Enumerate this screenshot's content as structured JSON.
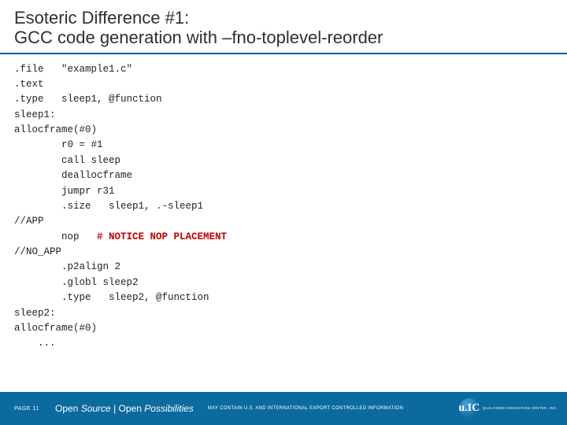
{
  "title": {
    "line1": "Esoteric Difference #1:",
    "line2": "GCC code generation with –fno-toplevel-reorder"
  },
  "code": {
    "l01": ".file   \"example1.c\"",
    "l02": ".text",
    "l03": ".type   sleep1, @function",
    "l04": "sleep1:",
    "l05": "allocframe(#0)",
    "l06": "        r0 = #1",
    "l07": "        call sleep",
    "l08": "        deallocframe",
    "l09": "        jumpr r31",
    "l10": "        .size   sleep1, .-sleep1",
    "l11": "//APP",
    "l12a": "        nop   ",
    "l12b": "# NOTICE NOP PLACEMENT",
    "l13": "//NO_APP",
    "l14": "        .p2align 2",
    "l15": "        .globl sleep2",
    "l16": "        .type   sleep2, @function",
    "l17": "sleep2:",
    "l18": "allocframe(#0)",
    "l19": "    ..."
  },
  "footer": {
    "page_label": "PAGE 11",
    "motto_prefix": "Open ",
    "motto_italic1": "Source",
    "motto_mid": " | Open ",
    "motto_italic2": "Possibilities",
    "legal": "MAY CONTAIN U.S. AND INTERNATIONAL EXPORT CONTROLLED INFORMATION",
    "logo_text": "u.IC",
    "logo_sub": "QUALCOMM INNOVATION CENTER, INC."
  }
}
